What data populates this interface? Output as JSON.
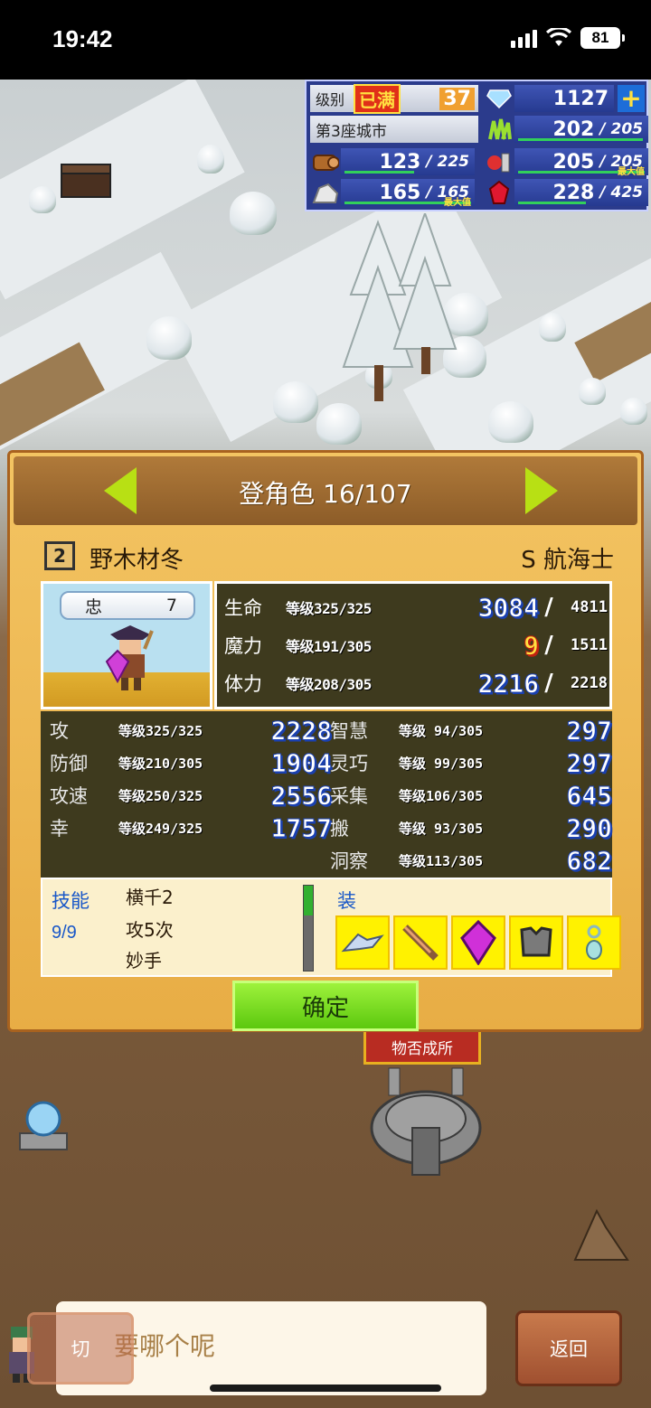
{
  "status_bar": {
    "time": "19:42",
    "battery": "81"
  },
  "hud": {
    "level_label": "级别",
    "max_badge": "已满",
    "level": "37",
    "city": "第3座城市",
    "gems": "1127",
    "resources": [
      {
        "icon": "grass-icon",
        "current": "202",
        "max": "205",
        "fill": 0.985,
        "maxed": false
      },
      {
        "icon": "wood-icon",
        "current": "123",
        "max": "225",
        "fill": 0.547,
        "maxed": false
      },
      {
        "icon": "food-icon",
        "current": "205",
        "max": "205",
        "fill": 1.0,
        "maxed": true,
        "max_tag": "最大值"
      },
      {
        "icon": "stone-icon",
        "current": "165",
        "max": "165",
        "fill": 1.0,
        "maxed": true,
        "max_tag": "最大值"
      },
      {
        "icon": "ruby-icon",
        "current": "228",
        "max": "425",
        "fill": 0.536,
        "maxed": false
      }
    ]
  },
  "panel": {
    "title": "登角色 16/107",
    "grade": "2",
    "name": "野木材冬",
    "job": "S 航海士",
    "loyalty_label": "忠",
    "loyalty": "7",
    "vitals": [
      {
        "name": "生命",
        "level": "等级325/325",
        "current": "3084",
        "max": "4811",
        "warn": false
      },
      {
        "name": "魔力",
        "level": "等级191/305",
        "current": "9",
        "max": "1511",
        "warn": true
      },
      {
        "name": "体力",
        "level": "等级208/305",
        "current": "2216",
        "max": "2218",
        "warn": false
      }
    ],
    "attrs_left": [
      {
        "name": "攻",
        "level": "等级325/325",
        "value": "2228"
      },
      {
        "name": "防御",
        "level": "等级210/305",
        "value": "1904"
      },
      {
        "name": "攻速",
        "level": "等级250/325",
        "value": "2556"
      },
      {
        "name": "幸",
        "level": "等级249/325",
        "value": "1757"
      }
    ],
    "attrs_right": [
      {
        "name": "智慧",
        "level": "等级 94/305",
        "value": "297"
      },
      {
        "name": "灵巧",
        "level": "等级 99/305",
        "value": "297"
      },
      {
        "name": "采集",
        "level": "等级106/305",
        "value": "645"
      },
      {
        "name": "搬",
        "level": "等级 93/305",
        "value": "290"
      },
      {
        "name": "洞察",
        "level": "等级113/305",
        "value": "682"
      }
    ],
    "skills_label": "技能",
    "skills_count": "9/9",
    "skills": [
      "横千2",
      "攻5次",
      "妙手"
    ],
    "skill_gauge": 0.35,
    "equip_label": "装",
    "equipment": [
      "wing-icon",
      "sword-icon",
      "gem-icon",
      "armor-icon",
      "amulet-icon"
    ],
    "confirm": "确定"
  },
  "world": {
    "building_sign": "物否成所"
  },
  "dialog": {
    "text": "要哪个呢"
  },
  "buttons": {
    "switch": "切",
    "back": "返回"
  }
}
